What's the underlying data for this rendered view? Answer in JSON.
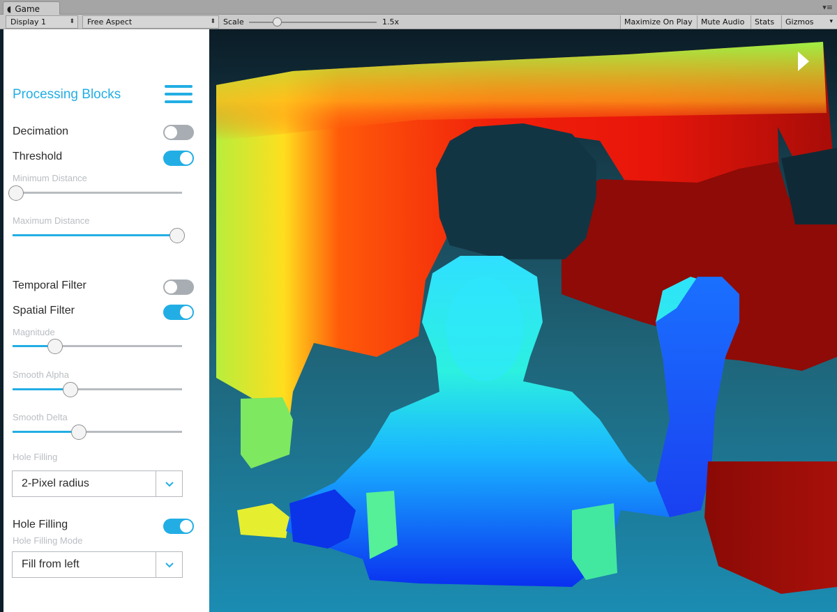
{
  "window": {
    "tab_icon": "unity-logo-icon",
    "tab_label": "Game",
    "tab_menu_icon": "▾≡"
  },
  "toolbar": {
    "display": "Display 1",
    "aspect": "Free Aspect",
    "scale_label": "Scale",
    "scale_value": "1.5x",
    "buttons": [
      "Maximize On Play",
      "Mute Audio",
      "Stats",
      "Gizmos"
    ]
  },
  "panel": {
    "title": "Processing Blocks",
    "decimation": {
      "label": "Decimation",
      "enabled": false
    },
    "threshold": {
      "label": "Threshold",
      "enabled": true,
      "min_label": "Minimum Distance",
      "min_value": 0.02,
      "max_label": "Maximum Distance",
      "max_value": 0.97
    },
    "temporal": {
      "label": "Temporal Filter",
      "enabled": false
    },
    "spatial": {
      "label": "Spatial Filter",
      "enabled": true,
      "magnitude_label": "Magnitude",
      "magnitude_value": 0.25,
      "alpha_label": "Smooth Alpha",
      "alpha_value": 0.34,
      "delta_label": "Smooth Delta",
      "delta_value": 0.39,
      "hole_label": "Hole Filling",
      "hole_value": "2-Pixel radius"
    },
    "hole_filling": {
      "label": "Hole Filling",
      "enabled": true,
      "mode_label": "Hole Filling Mode",
      "mode_value": "Fill from left"
    }
  },
  "colors": {
    "accent": "#22aee4",
    "toggle_off": "#a7adb2",
    "panel_bg": "#ffffff"
  },
  "icons": {
    "play": "play-icon",
    "menu": "hamburger-menu-icon",
    "dropdown": "chevron-down-icon"
  }
}
